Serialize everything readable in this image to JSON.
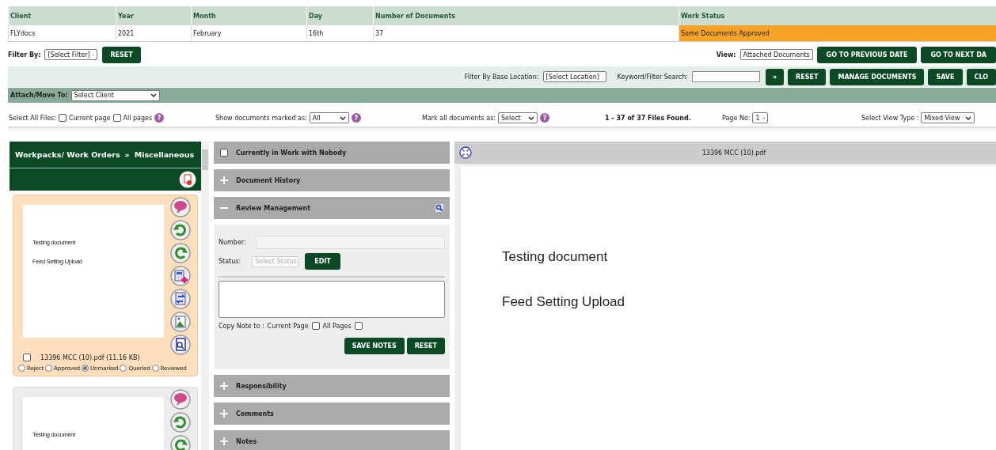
{
  "table": {
    "columns": [
      "Client",
      "Year",
      "Month",
      "Day",
      "Number of Documents",
      "Work Status"
    ],
    "rows": [
      {
        "cells": [
          "FLYdocs",
          "2021",
          "February",
          "16th",
          "37",
          "Some Documents Approved"
        ]
      }
    ]
  },
  "filter_bar": {
    "filter_label": "Filter By:",
    "filter_select": "[Select Filter]",
    "reset": "RESET",
    "view_label": "View:",
    "view_select": "Attached Documents",
    "buttons": [
      "GO TO PREVIOUS DATE",
      "GO TO NEXT DA"
    ]
  },
  "search_bar": {
    "location_label": "Filter By Base Location:",
    "location_select": "[Select Location]",
    "keyword_label": "Keyword/Filter Search:",
    "go": "»",
    "buttons": [
      "RESET",
      "MANAGE DOCUMENTS",
      "SAVE",
      "CLO"
    ]
  },
  "attach_bar": {
    "label": "Attach/Move To:",
    "select": "Select Client"
  },
  "options_bar": {
    "select_all_label": "Select All Files:",
    "select_all": [
      {
        "label": "Current page",
        "checked": false
      },
      {
        "label": "All pages",
        "checked": false
      }
    ],
    "select_help": "?",
    "show_label": "Show documents marked as:",
    "show_select": "All",
    "show_help": "?",
    "mark_label": "Mark all documents as:",
    "mark_select": "Select",
    "mark_help": "?",
    "files_found": "1 - 37 of 37 Files Found.",
    "page_label": "Page No:",
    "page_select": "1",
    "view_type_label": "Select View Type :",
    "view_type_select": "Mixed View"
  },
  "sidebar": {
    "breadcrumb": [
      "Workpacks/ Work Orders",
      "»",
      "Miscellaneous"
    ],
    "documents": [
      {
        "selected": true,
        "thumbnail_lines": [
          "Testing document",
          "Feed Setting Upload"
        ],
        "file_name": "13396 MCC (10).pdf (11.16 KB)",
        "checked": false,
        "marks": [
          {
            "label": "Reject",
            "selected": false
          },
          {
            "label": "Approved",
            "selected": false
          },
          {
            "label": "Unmarked",
            "selected": true
          },
          {
            "label": "Queried",
            "selected": false
          },
          {
            "label": "Reviewed",
            "selected": false
          }
        ]
      },
      {
        "selected": false,
        "thumbnail_lines": [
          "Testing document"
        ]
      }
    ]
  },
  "panels": [
    {
      "kind": "checkbox",
      "title": "Currently in Work with Nobody",
      "checked": false
    },
    {
      "kind": "section",
      "title": "Document History",
      "expanded": false
    },
    {
      "kind": "section",
      "title": "Review Management",
      "expanded": true
    },
    {
      "kind": "section",
      "title": "Responsibility",
      "expanded": false
    },
    {
      "kind": "section",
      "title": "Comments",
      "expanded": false
    },
    {
      "kind": "section",
      "title": "Notes",
      "expanded": false
    }
  ],
  "review": {
    "number_label": "Number:",
    "status_label": "Status:",
    "status_select": "Select Status",
    "edit": "EDIT",
    "copy_label": "Copy Note to :",
    "copy_options": [
      {
        "label": "Current Page",
        "checked": false
      },
      {
        "label": "All Pages",
        "checked": false
      }
    ],
    "buttons": [
      "SAVE NOTES",
      "RESET"
    ]
  },
  "viewer": {
    "file_name": "13396 MCC (10).pdf",
    "lines": [
      "Testing document",
      "Feed Setting Upload"
    ]
  }
}
